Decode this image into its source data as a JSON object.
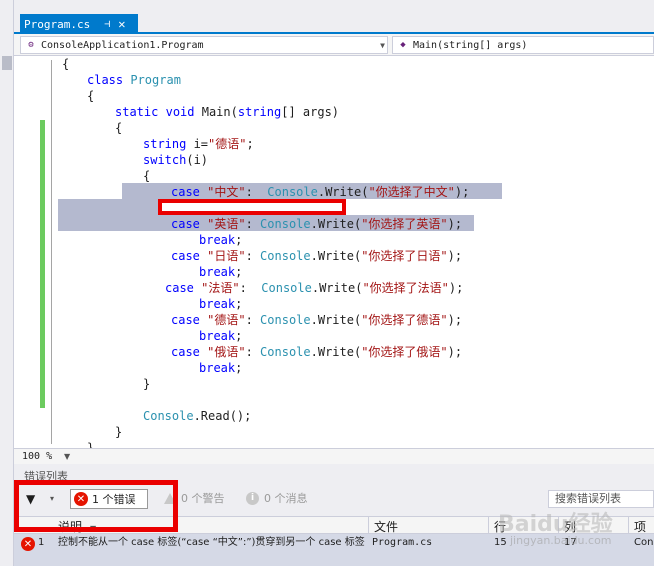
{
  "tab": {
    "title": "Program.cs",
    "pin": "⊣",
    "close": "✕"
  },
  "navbar": {
    "left": "ConsoleApplication1.Program",
    "right": "Main(string[] args)"
  },
  "code": {
    "lines": [
      [
        "{"
      ],
      [
        "class Program"
      ],
      [
        "{"
      ],
      [
        "static void Main(string[] args)"
      ],
      [
        "{"
      ],
      [
        "string i=\"德语\";"
      ],
      [
        "switch(i)"
      ],
      [
        "{"
      ],
      [
        "case \"中文\":  Console.Write(\"你选择了中文\");"
      ],
      [
        ""
      ],
      [
        "case \"英语\": Console.Write(\"你选择了英语\");"
      ],
      [
        "break;"
      ],
      [
        "case \"日语\": Console.Write(\"你选择了日语\");"
      ],
      [
        "break;"
      ],
      [
        "case \"法语\":  Console.Write(\"你选择了法语\");"
      ],
      [
        "break;"
      ],
      [
        "case \"德语\": Console.Write(\"你选择了德语\");"
      ],
      [
        "break;"
      ],
      [
        "case \"俄语\": Console.Write(\"你选择了俄语\");"
      ],
      [
        "break;"
      ],
      [
        "}"
      ],
      [
        ""
      ],
      [
        "Console.Read();"
      ],
      [
        "}"
      ],
      [
        "}"
      ]
    ]
  },
  "zoom": "100 %",
  "errorlist": {
    "title": "错误列表",
    "errors_btn": "1 个错误",
    "warnings_btn": "0 个警告",
    "messages_btn": "0 个消息",
    "search_placeholder": "搜索错误列表",
    "columns": {
      "desc": "说明",
      "file": "文件",
      "line": "行",
      "col": "列",
      "project": "项目"
    },
    "row": {
      "num": "1",
      "desc": "控制不能从一个 case 标签(“case “中文”:”)贯穿到另一个 case 标签",
      "file": "Program.cs",
      "line": "15",
      "col": "17",
      "project": "Cons"
    }
  },
  "watermark": {
    "main": "Baidu经验",
    "sub": "jingyan.baidu.com"
  },
  "colors": {
    "accent": "#007acc",
    "error": "#e51400",
    "highlight": "#ea0000",
    "selection": "#b4b9cf"
  }
}
